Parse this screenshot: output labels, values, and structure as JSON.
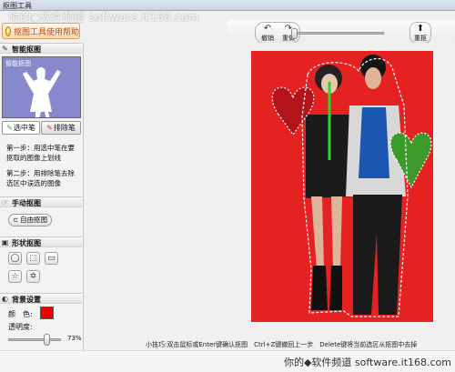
{
  "window": {
    "title": "抠图工具",
    "watermark_top": "你的◆软件频道 software.it168.com"
  },
  "help_button": {
    "label": "抠图工具使用帮助"
  },
  "toolbar": {
    "undo_label": "撤销",
    "redo_label": "重做",
    "reset_label": "重抠",
    "zoom_level": 0
  },
  "left_panel": {
    "smart": {
      "header": "智能抠图",
      "preview_caption": "智能抠图",
      "select_pen_label": "选中笔",
      "erase_pen_label": "排除笔",
      "step1": "第一步：用选中笔在要抠取的图像上划线",
      "step2": "第二步：用排除笔去除选区中误选的图像"
    },
    "manual": {
      "header": "手动抠图",
      "free_button_label": "自由抠图"
    },
    "shape": {
      "header": "形状抠图",
      "shapes": [
        {
          "icon": "ellipse-icon",
          "glyph": "◯"
        },
        {
          "icon": "rect-select-icon",
          "glyph": "⬚"
        },
        {
          "icon": "rounded-rect-icon",
          "glyph": "▭"
        },
        {
          "icon": "star-icon",
          "glyph": "☆"
        },
        {
          "icon": "badge-star-icon",
          "glyph": "✡"
        }
      ]
    },
    "mask": {
      "header": "背景设置",
      "color_label": "颜　色:",
      "color_value": "#ee0000",
      "opacity_label": "透明度:",
      "opacity_percent": 73,
      "opacity_text": "73%"
    }
  },
  "bottom": {
    "tip": "小技巧:双击鼠标或Enter键确认抠图　Ctrl+Z键撤回上一步　Delete键将当前选区从抠图中去掉",
    "watermark": "你的◆软件频道 software.it168.com"
  }
}
